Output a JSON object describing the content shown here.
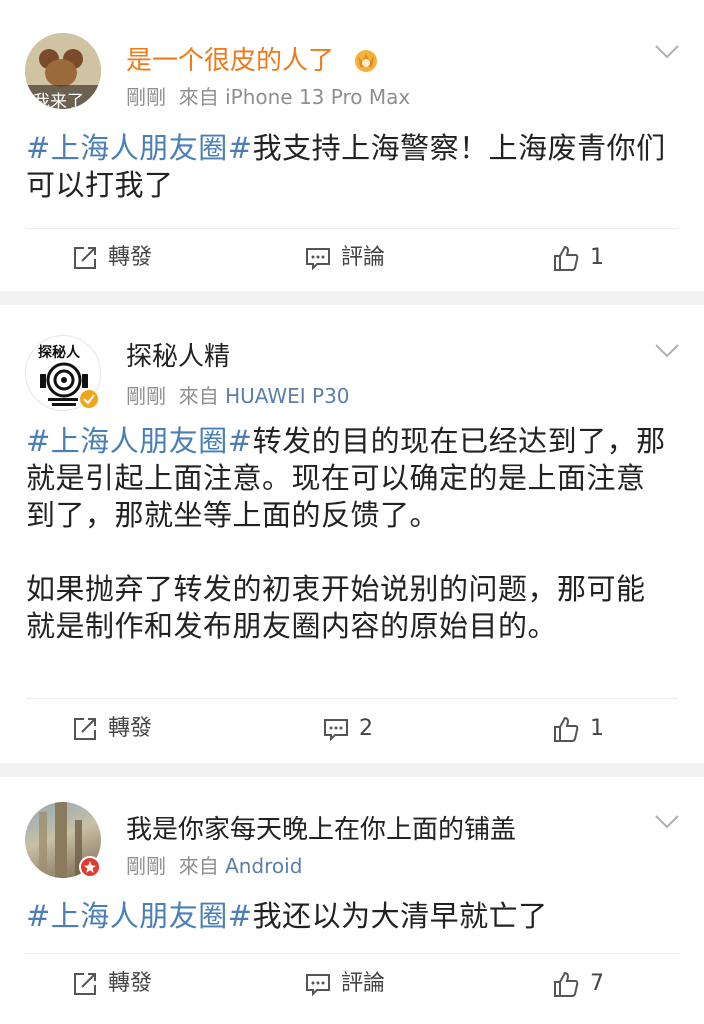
{
  "posts": [
    {
      "username": "是一个很皮的人了",
      "username_color": "#f07a1a",
      "avatar_caption": "我来了",
      "time": "剛剛",
      "source_prefix": "來自",
      "device": "iPhone 13 Pro Max",
      "hashtag": "#上海人朋友圈#",
      "text": "我支持上海警察！上海废青你们可以打我了",
      "repost_label": "轉發",
      "comment_label": "評論",
      "like_count": "1"
    },
    {
      "username": "探秘人精",
      "username_color": "#222222",
      "avatar_caption": "探秘人",
      "time": "剛剛",
      "source_prefix": "來自",
      "device": "HUAWEI P30",
      "hashtag": "#上海人朋友圈#",
      "text": "转发的目的现在已经达到了，那就是引起上面注意。现在可以确定的是上面注意到了，那就坐等上面的反馈了。",
      "text2": "如果抛弃了转发的初衷开始说别的问题，那可能就是制作和发布朋友圈内容的原始目的。",
      "repost_label": "轉發",
      "comment_label": "2",
      "like_count": "1"
    },
    {
      "username": "我是你家每天晚上在你上面的铺盖",
      "username_color": "#222222",
      "time": "剛剛",
      "source_prefix": "來自",
      "device": "Android",
      "hashtag": "#上海人朋友圈#",
      "text": "我还以为大清早就亡了",
      "repost_label": "轉發",
      "comment_label": "評論",
      "like_count": "7"
    }
  ],
  "colors": {
    "hashtag": "#4a7fb5",
    "device_link": "#5b7fa8",
    "meta_gray": "#8f8f8f",
    "page_bg": "#f2f2f2"
  },
  "icons": [
    "chevron-down-icon",
    "repost-icon",
    "comment-icon",
    "like-icon",
    "crown-badge-icon",
    "verified-badge-icon",
    "red-badge-icon"
  ]
}
